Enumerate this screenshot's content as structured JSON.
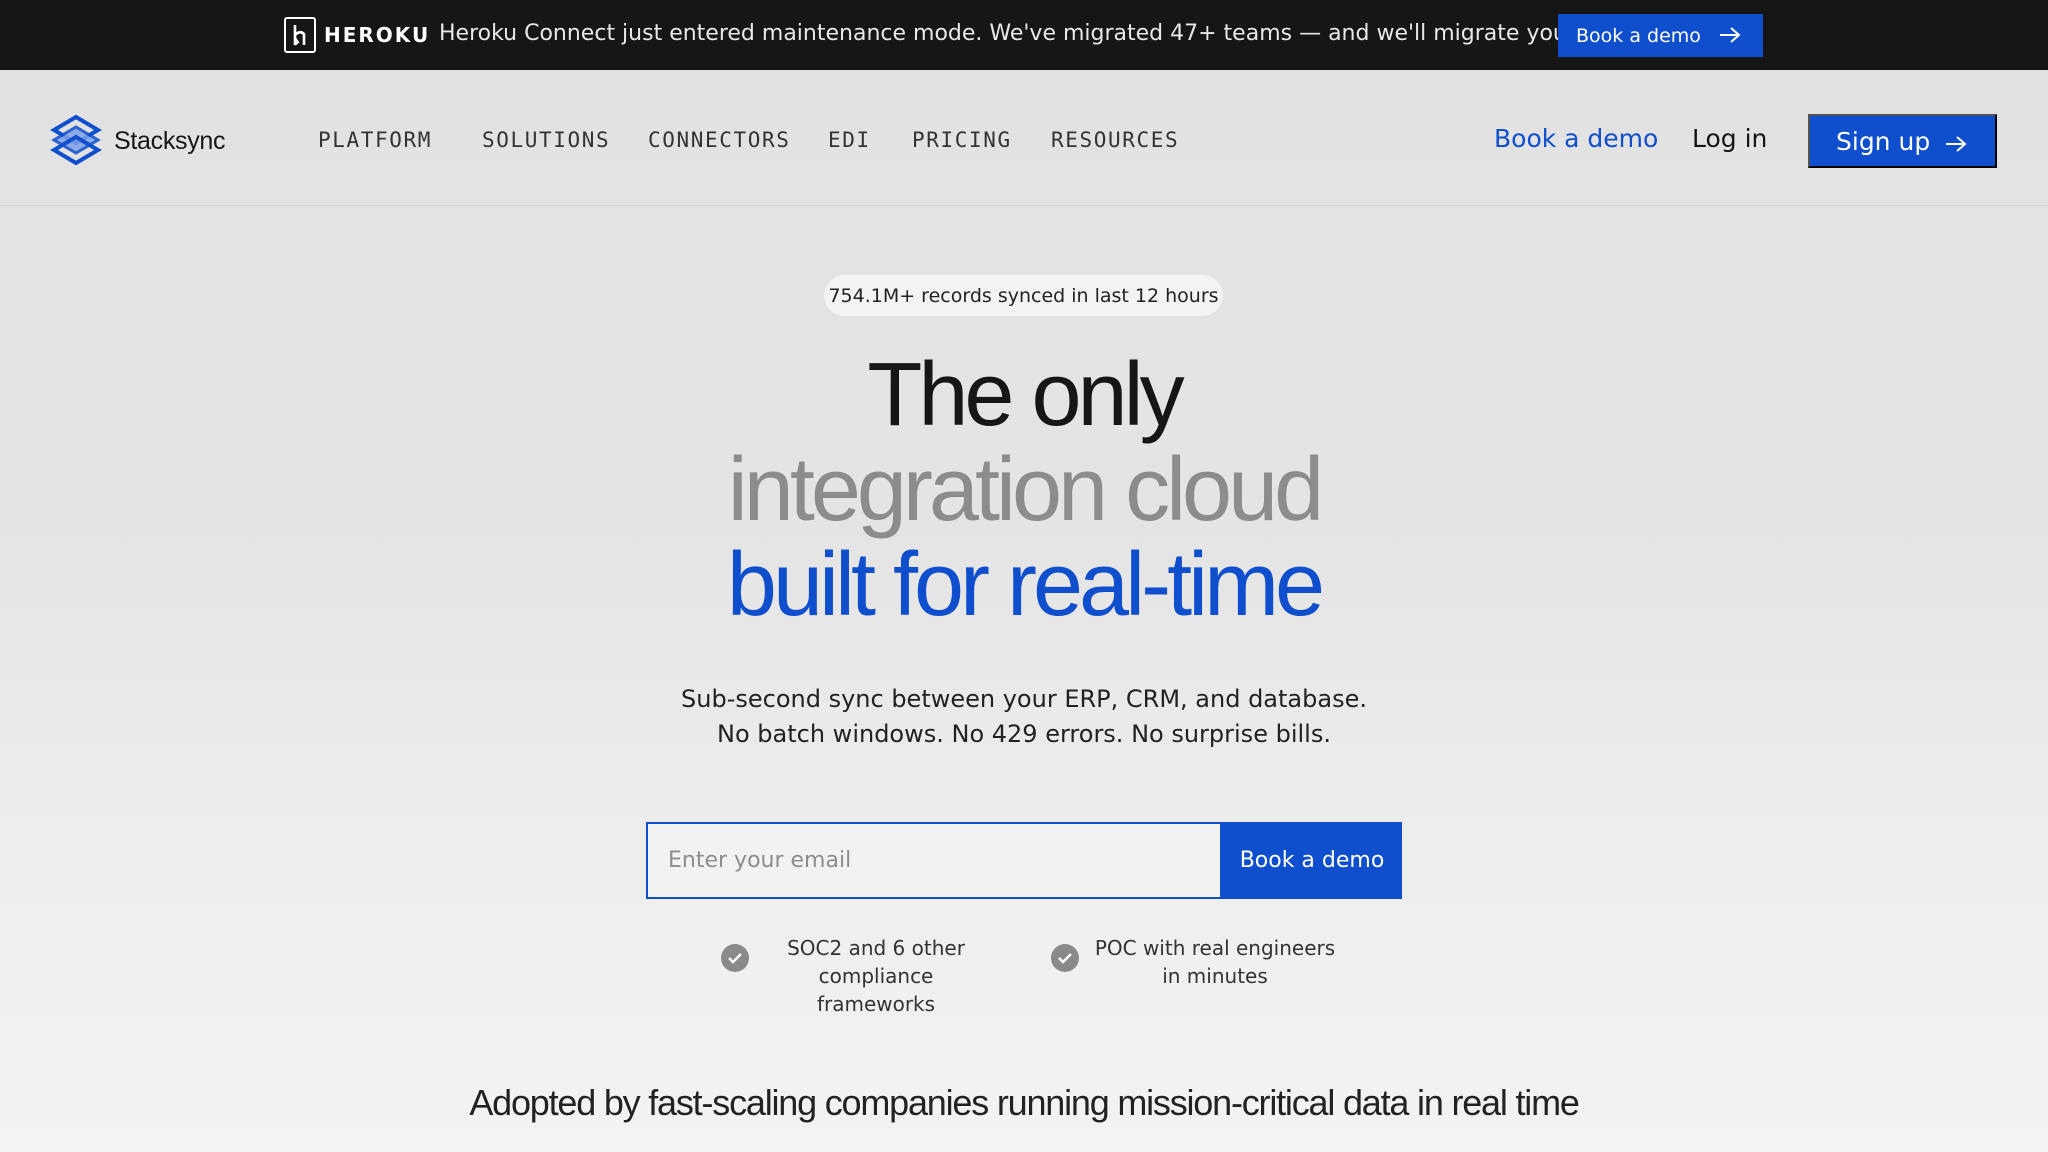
{
  "announcement": {
    "brand": "HEROKU",
    "message": "Heroku Connect just entered maintenance mode. We've migrated 47+ teams — and we'll migrate yours free.",
    "button_label": "Book a demo"
  },
  "header": {
    "brand_name": "Stacksync",
    "nav": [
      "PLATFORM",
      "SOLUTIONS",
      "CONNECTORS",
      "EDI",
      "PRICING",
      "RESOURCES"
    ],
    "book_demo": "Book a demo",
    "login": "Log in",
    "signup": "Sign up"
  },
  "hero": {
    "stat_pill": "754.1M+ records synced in last 12 hours",
    "headline_line1": "The only",
    "headline_line2": "integration cloud",
    "headline_line3": "built for real-time",
    "sub_line1": "Sub-second sync between your ERP, CRM, and database.",
    "sub_line2": "No batch windows. No 429 errors. No surprise bills.",
    "email_placeholder": "Enter your email",
    "submit_label": "Book a demo",
    "checks": [
      {
        "line1": "SOC2 and 6 other",
        "line2": "compliance frameworks"
      },
      {
        "line1": "POC with real engineers",
        "line2": "in minutes"
      }
    ]
  },
  "adopted_heading": "Adopted by fast-scaling companies running mission-critical data in real time",
  "colors": {
    "accent": "#0f4ecc",
    "announce_bg": "#161616",
    "headline_gray": "#8c8c8c"
  }
}
